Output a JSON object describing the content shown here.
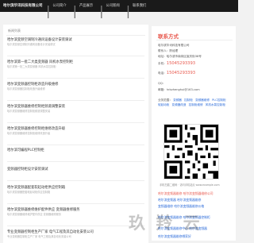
{
  "header": {
    "brand": "哈尔滨华讯科技有限公司",
    "nav": [
      "公司简介",
      "产品展示",
      "公司新闻",
      "联系我们"
    ]
  },
  "articles_panel": {
    "title": "新闻列表",
    "articles": [
      {
        "title": "哈尔滨变频空调制冷通风设备设计安装调试",
        "summary": "哈尔滨变频空调制冷通风设备设计安装调试"
      },
      {
        "title": "哈尔滨第一批二大类变频器 风机水泵控制柜",
        "summary": "哈尔滨第一批二大类变频器 风机水泵控制柜"
      },
      {
        "title": "哈尔滨变频器控制柜改造升级维修",
        "summary": "哈尔滨变频器控制柜改造升级维修"
      },
      {
        "title": "哈尔滨变频器维修控制柜频道调整安装",
        "summary": "哈尔滨变频器维修控制柜频道调整安装"
      },
      {
        "title": "哈尔滨变频器维修控制柜维修改造升级",
        "summary": "哈尔滨变频器维修控制柜维修改造升级"
      },
      {
        "title": "哈尔滨可编程PLC控制柜",
        "summary": ""
      },
      {
        "title": "变频器控制柜设计安装调试",
        "summary": ""
      },
      {
        "title": "哈尔滨变频器配套软起动柜供应控制箱",
        "summary": "哈尔滨变频器配套软起动柜供应控制箱"
      },
      {
        "title": "哈尔滨变频器维修维护配件供应 变频器维修服务",
        "summary": "哈尔滨变频器维修维护配件供应 变频器维修服务"
      },
      {
        "title": "专业变频器控制柜生产厂家 电气工程及其自动化安装公司",
        "summary": "专业变频器控制柜生产厂家 电气工程及其自动化安装公司"
      }
    ]
  },
  "contact": {
    "title": "联系方式",
    "company": "哈尔滨华讯科技有限公司",
    "contact_person": "联系人：陈经理",
    "address": "地址：哈尔滨市南岗区宣庆街38号",
    "mobile_label": "手机：",
    "mobile": "15045293393",
    "phone_label": "电话：",
    "phone": "15045293393",
    "qq": "QQ：",
    "email": "邮箱：hrbzhenghui@163.com",
    "tags_label": "业务范围：",
    "tags": [
      "变频器",
      "控制柜",
      "变频器维修",
      "PLC控制柜",
      "软起动柜",
      "变频器改造",
      "控制柜维修",
      "风机水泵控制柜"
    ],
    "qr_caption": "手机扫描二维码 · 访问手机站点 www.example.com"
  },
  "related": {
    "items": [
      "哈尔滨变频器维修 哈尔滨变频器维修公司",
      "哈尔滨变频器 哈尔滨变频器维修",
      "变频器维修 哈尔滨变频器维修价格",
      "哈尔滨变频器维修 哈尔滨变频器控制柜",
      "哈尔滨变频器维修中心 哈尔滨变频器",
      "哈尔滨变频器维修哪家好"
    ]
  },
  "watermark": {
    "text": "玖 羚 云"
  }
}
